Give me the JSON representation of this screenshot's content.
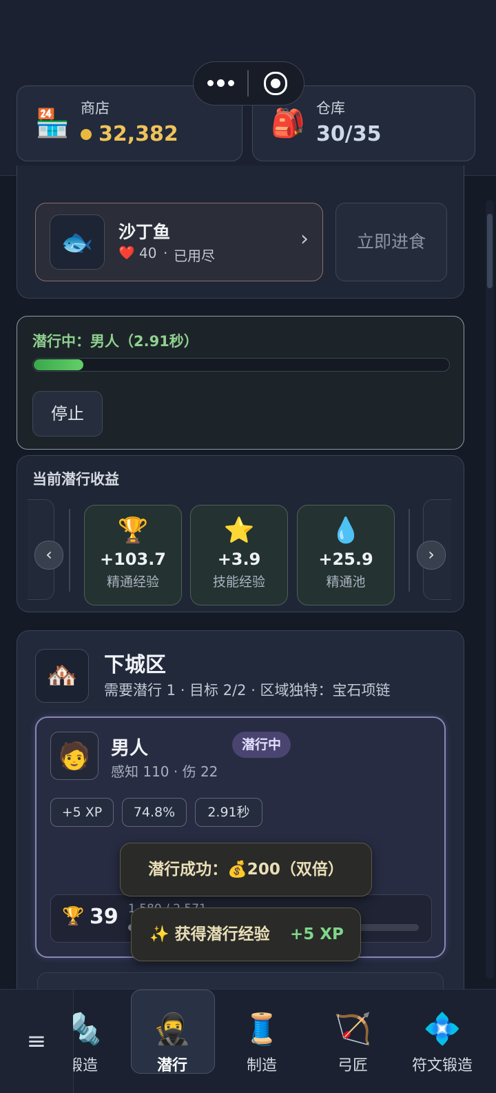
{
  "header": {
    "shop": {
      "icon": "convenience-store-icon",
      "emoji": "🏪",
      "title": "商店",
      "coin_icon": "gold-coin-icon",
      "value": "32,382"
    },
    "storage": {
      "icon": "backpack-icon",
      "emoji": "🎒",
      "title": "仓库",
      "value": "30/35"
    },
    "capsule": {
      "more_icon": "more-dots-icon",
      "close_icon": "target-circle-icon"
    }
  },
  "food": {
    "icon": "fish-icon",
    "emoji": "🐟",
    "name": "沙丁鱼",
    "heart_emoji": "❤️",
    "hp": "40",
    "separator": "·",
    "status": "已用尽",
    "chevron": "›",
    "eat_button": "立即进食"
  },
  "sneaking": {
    "label": "潜行中：男人（2.91秒）",
    "progress": 0.12,
    "stop_button": "停止"
  },
  "gains": {
    "title": "当前潜行收益",
    "prev": "‹",
    "next": "›",
    "items": [
      {
        "emoji": "🏆",
        "icon": "trophy-icon",
        "value": "+103.7",
        "label": "精通经验"
      },
      {
        "emoji": "⭐",
        "icon": "star-icon",
        "value": "+3.9",
        "label": "技能经验"
      },
      {
        "emoji": "💧",
        "icon": "droplet-icon",
        "value": "+25.9",
        "label": "精通池"
      }
    ]
  },
  "area": {
    "emoji": "🏘️",
    "icon": "houses-icon",
    "title": "下城区",
    "subtitle": "需要潜行 1 · 目标 2/2 · 区域独特：宝石项链"
  },
  "target": {
    "emoji": "🧑",
    "icon": "man-avatar-icon",
    "name": "男人",
    "badge": "潜行中",
    "stats": "感知 110 · 伤 22",
    "pills": [
      "+5 XP",
      "74.8%",
      "2.91秒"
    ],
    "trophy_emoji": "🏆",
    "level": "39",
    "progress_text": "1,580 / 2,571"
  },
  "toasts": {
    "success": "潜行成功：💰200（双倍）",
    "xp_prefix": "✨ 获得潜行经验",
    "xp_value": "+5 XP"
  },
  "nav": {
    "menu_icon": "≡",
    "items": [
      {
        "emoji": "🔩",
        "icon": "nut-bolt-icon",
        "label": "锻造"
      },
      {
        "emoji": "🥷",
        "icon": "ninja-icon",
        "label": "潜行"
      },
      {
        "emoji": "🧵",
        "icon": "thread-spool-icon",
        "label": "制造"
      },
      {
        "emoji": "🏹",
        "icon": "bow-arrow-icon",
        "label": "弓匠"
      },
      {
        "emoji": "💠",
        "icon": "diamond-dot-icon",
        "label": "符文锻造"
      }
    ],
    "active": "潜行"
  },
  "colors": {
    "accent_gold": "#f0c35a",
    "progress_green": "#4cc45a",
    "xp_green": "#7fd68a",
    "badge_purple": "#4a4470"
  }
}
